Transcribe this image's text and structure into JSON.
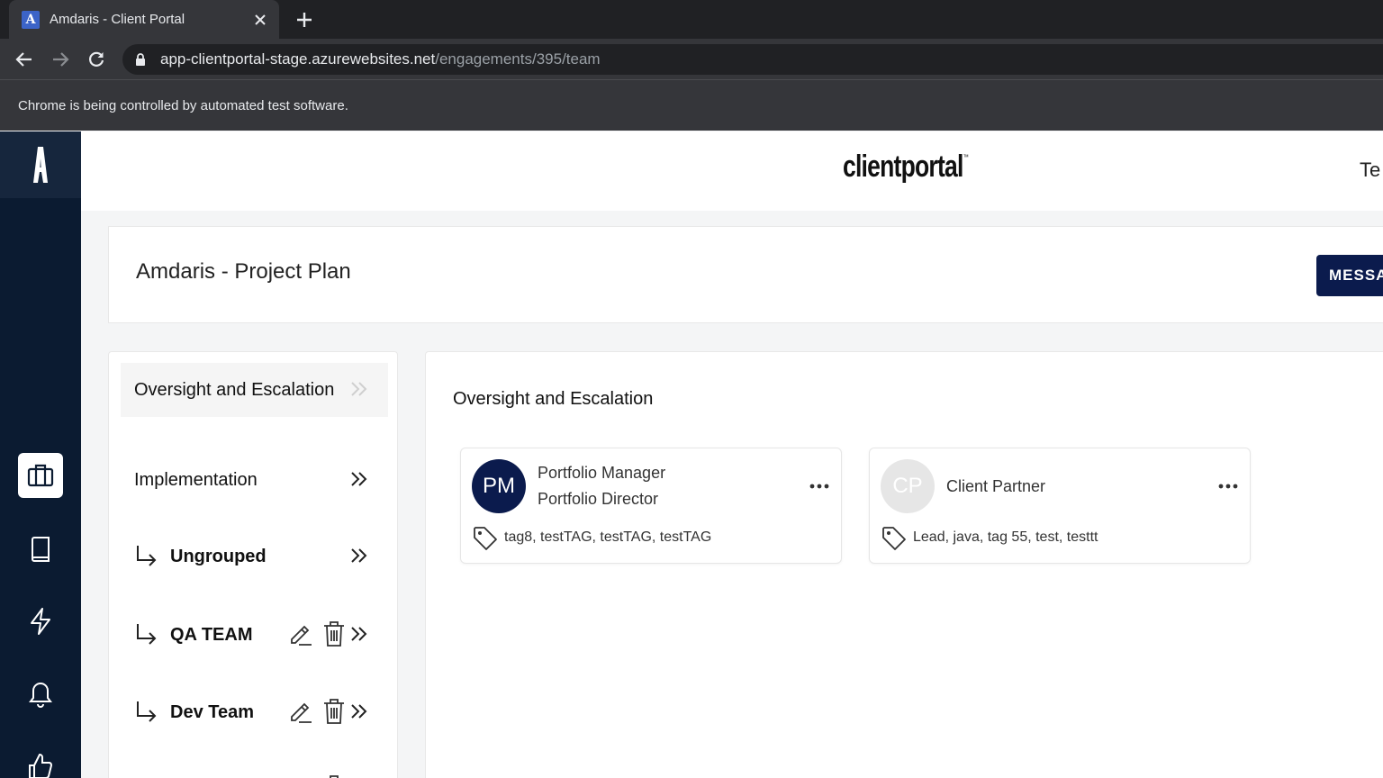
{
  "browser": {
    "tab_title": "Amdaris - Client Portal",
    "tab_favicon_letter": "A",
    "url_host": "app-clientportal-stage.azurewebsites.net",
    "url_path": "/engagements/395/team",
    "infobar_text": "Chrome is being controlled by automated test software."
  },
  "header": {
    "brand": "clientportal",
    "brand_mark": "™",
    "user_initial": "Te"
  },
  "project": {
    "title": "Amdaris - Project Plan",
    "message_button": "MESSAGES"
  },
  "groups": [
    {
      "label": "Oversight and Escalation",
      "selected": true
    },
    {
      "label": "Implementation"
    },
    {
      "label": "Ungrouped"
    },
    {
      "label": "QA TEAM"
    },
    {
      "label": "Dev Team"
    }
  ],
  "members_panel": {
    "heading": "Oversight and Escalation",
    "members": [
      {
        "initials": "PM",
        "role": "Portfolio Manager",
        "title": "Portfolio Director",
        "tags": "tag8, testTAG, testTAG, testTAG"
      },
      {
        "initials": "CP",
        "role": "Client Partner",
        "title": "",
        "tags": "Lead, java, tag 55, test, testtt"
      }
    ]
  },
  "colors": {
    "sidebar": "#0b1b31",
    "accent": "#0b1b4d",
    "chrome_dark": "#202124",
    "chrome_mid": "#35363a"
  }
}
